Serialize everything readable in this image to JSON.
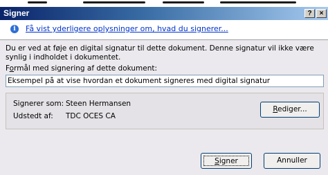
{
  "window": {
    "title": "Signer",
    "help_glyph": "?",
    "close_glyph": "×"
  },
  "info": {
    "icon": "info-icon",
    "link_text": "Få vist yderligere oplysninger om, hvad du signerer..."
  },
  "description": "Du er ved at føje en digital signatur til dette dokument. Denne signatur vil ikke være synlig i indholdet i dokumentet.",
  "purpose": {
    "label_prefix": "F",
    "label_accel": "o",
    "label_rest": "rmål med signering af dette dokument:",
    "value": "Eksempel på at vise hvordan et dokument signeres med digital signatur"
  },
  "signer_info": {
    "signer_label": "Signerer som:",
    "signer_value": "Steen Hermansen",
    "issuer_label": "Udstedt af:",
    "issuer_value": "TDC OCES CA"
  },
  "buttons": {
    "edit_accel": "R",
    "edit_rest": "ediger...",
    "sign_accel": "S",
    "sign_rest": "igner",
    "cancel": "Annuller"
  },
  "colors": {
    "title_gradient_start": "#0a246a",
    "title_gradient_end": "#a6caf0",
    "link": "#0033cc",
    "dialog_bg": "#ebe9ed"
  }
}
